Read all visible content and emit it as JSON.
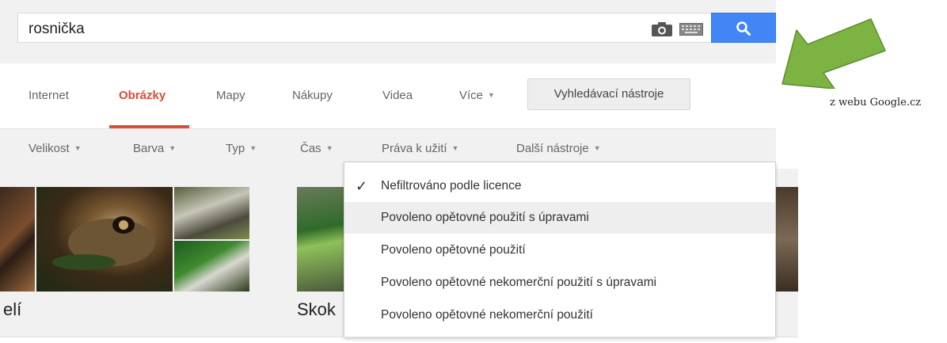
{
  "search": {
    "query": "rosnička"
  },
  "tabs": [
    {
      "label": "Internet"
    },
    {
      "label": "Obrázky"
    },
    {
      "label": "Mapy"
    },
    {
      "label": "Nákupy"
    },
    {
      "label": "Videa"
    },
    {
      "label": "Více"
    }
  ],
  "tools_button": {
    "label": "Vyhledávací nástroje"
  },
  "filters": [
    {
      "label": "Velikost"
    },
    {
      "label": "Barva"
    },
    {
      "label": "Typ"
    },
    {
      "label": "Čas"
    },
    {
      "label": "Práva k užití"
    },
    {
      "label": "Další nástroje"
    }
  ],
  "rights_menu": {
    "items": [
      {
        "label": "Nefiltrováno podle licence",
        "checked": true
      },
      {
        "label": "Povoleno opětovné použití s úpravami"
      },
      {
        "label": "Povoleno opětovné použití"
      },
      {
        "label": "Povoleno opětovné nekomerční použití s úpravami"
      },
      {
        "label": "Povoleno opětovné nekomerční použití"
      }
    ]
  },
  "results": [
    {
      "title": "elí"
    },
    {
      "title": "Skok"
    }
  ],
  "note": {
    "text": "z webu Google.cz"
  },
  "colors": {
    "accent_red": "#dd4b39",
    "search_blue": "#4285f4",
    "arrow_green": "#7cb342"
  },
  "icons": {
    "camera": "camera-icon",
    "keyboard": "keyboard-icon",
    "search": "search-icon",
    "check": "check-icon"
  }
}
